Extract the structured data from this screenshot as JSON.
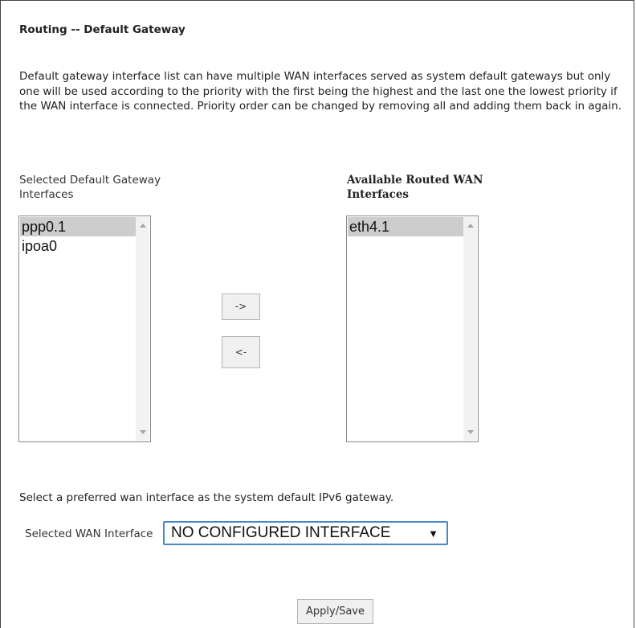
{
  "page": {
    "title": "Routing -- Default Gateway",
    "description": "Default gateway interface list can have multiple WAN interfaces served as system default gateways but only one will be used according to the priority with the first being the highest and the last one the lowest priority if the WAN interface is connected. Priority order can be changed by removing all and adding them back in again."
  },
  "selected_list": {
    "label_line1": "Selected Default Gateway",
    "label_line2": "Interfaces",
    "items": [
      {
        "label": "ppp0.1",
        "selected": true
      },
      {
        "label": "ipoa0",
        "selected": false
      }
    ]
  },
  "available_list": {
    "label_line1": "Available Routed WAN",
    "label_line2": "Interfaces",
    "items": [
      {
        "label": "eth4.1",
        "selected": true
      }
    ]
  },
  "buttons": {
    "add_label": "->",
    "remove_label": "<-",
    "apply_label": "Apply/Save"
  },
  "ipv6": {
    "prompt": "Select a preferred wan interface as the system default IPv6 gateway.",
    "field_label": "Selected WAN Interface",
    "selected_value": "NO CONFIGURED INTERFACE",
    "caret": "▼"
  }
}
